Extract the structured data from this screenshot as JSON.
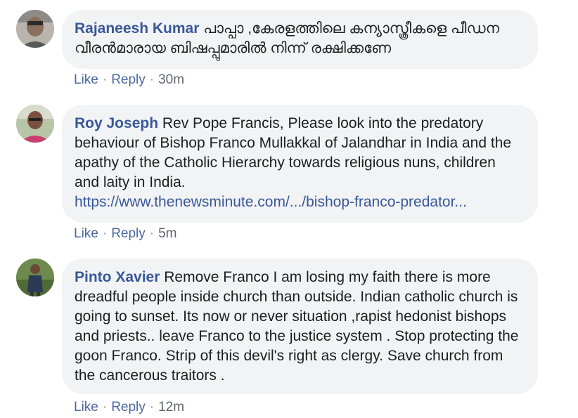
{
  "comments": [
    {
      "author": "Rajaneesh Kumar",
      "text": "പാപ്പാ ,കേരളത്തിലെ കന്യാസ്ത്രീകളെ പീഡന വീരൻമാരായ ബിഷപ്പുമാരിൽ നിന്ന് രക്ഷിക്കണേ",
      "like": "Like",
      "reply": "Reply",
      "sep": "·",
      "time": "30m"
    },
    {
      "author": "Roy Joseph",
      "text": "Rev Pope Francis, Please look into the predatory behaviour of Bishop Franco Mullakkal of Jalandhar in India and the apathy of the Catholic Hierarchy towards religious nuns, children and laity in India.",
      "link": "https://www.thenewsminute.com/.../bishop-franco-predator...",
      "like": "Like",
      "reply": "Reply",
      "sep": "·",
      "time": "5m"
    },
    {
      "author": "Pinto Xavier",
      "text": "Remove Franco I am losing my faith there is more dreadful people inside church than outside. Indian catholic church is going to sunset. Its now or never situation ,rapist hedonist bishops and priests.. leave Franco to the justice system . Stop protecting the goon Franco. Strip of this devil's right as clergy. Save church from the cancerous traitors .",
      "like": "Like",
      "reply": "Reply",
      "sep": "·",
      "time": "12m"
    }
  ]
}
